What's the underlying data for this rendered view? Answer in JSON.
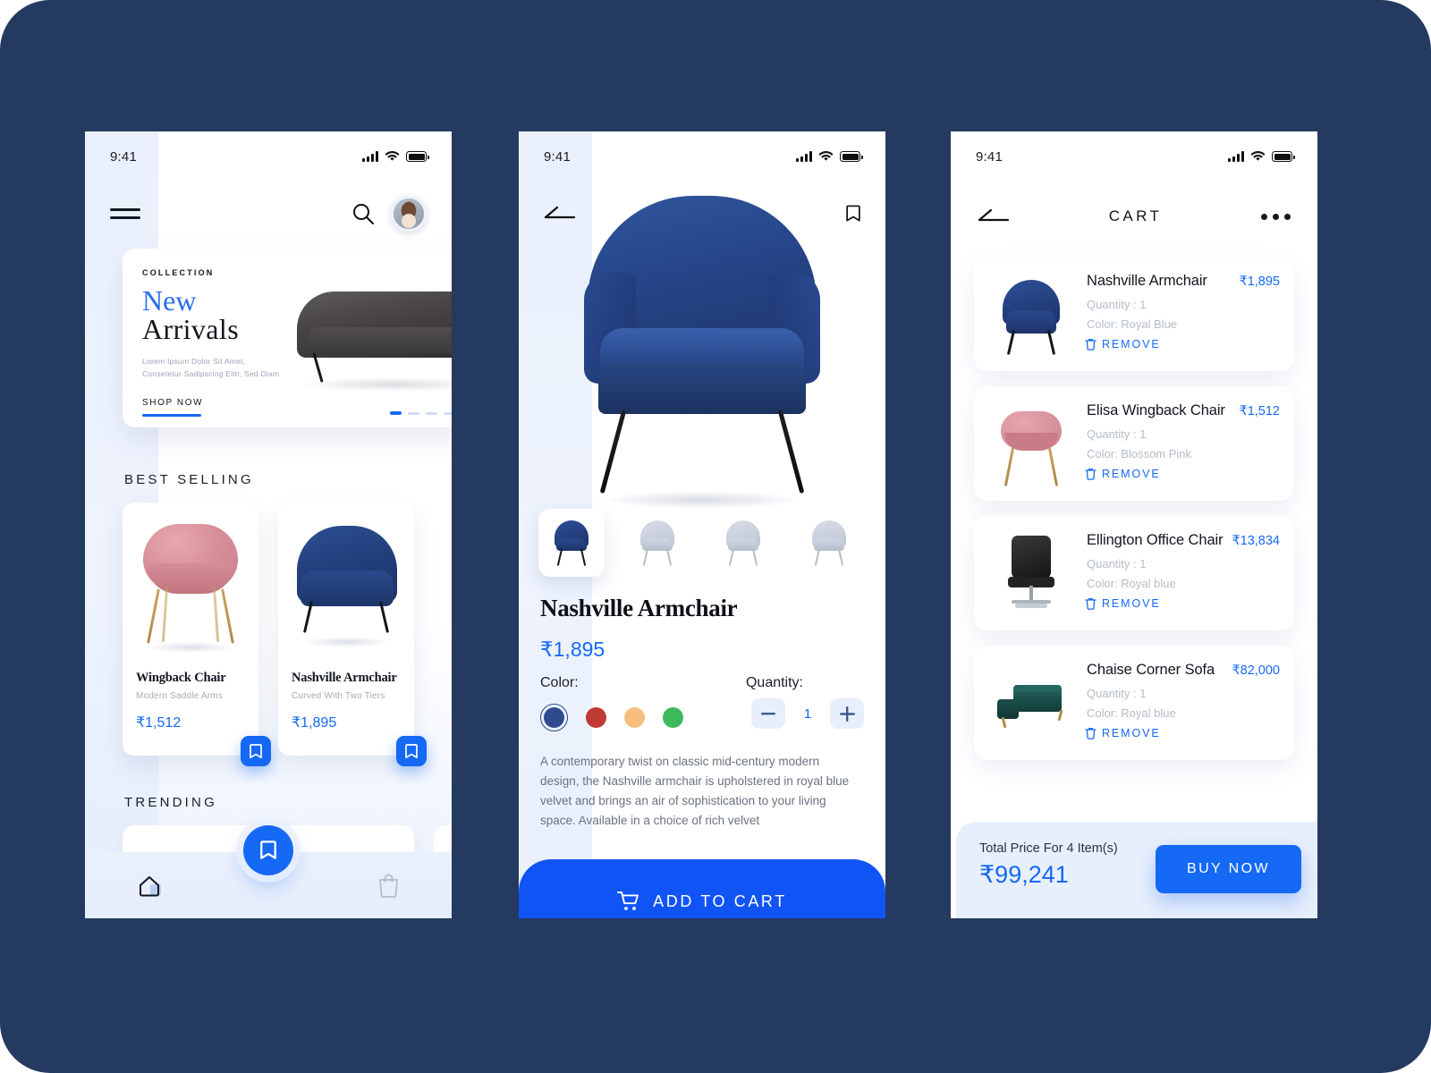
{
  "theme": {
    "page_bg": "#253A60",
    "accent": "#1569F4",
    "text_dark": "#12161F",
    "muted": "#A4ACBA"
  },
  "status_bar": {
    "time": "9:41"
  },
  "home": {
    "menu_icon": "hamburger-icon",
    "search_icon": "search-icon",
    "avatar": "user-avatar",
    "banner": {
      "eyebrow": "COLLECTION",
      "title_line1": "New",
      "title_line2": "Arrivals",
      "subtitle_line1": "Lorem Ipsum Dolor Sit Amet,",
      "subtitle_line2": "Consetetur Sadipscing Elitr, Sed Diam",
      "cta": "SHOP NOW",
      "slides": 4,
      "active_slide": 1
    },
    "sections": [
      {
        "title": "BEST SELLING"
      },
      {
        "title": "TRENDING"
      }
    ],
    "products": [
      {
        "name": "Wingback Chair",
        "desc": "Modern Saddle Arms",
        "price": "₹1,512",
        "bookmark_icon": "bookmark-icon"
      },
      {
        "name": "Nashville Armchair",
        "desc": "Curved With Two Tiers",
        "price": "₹1,895",
        "bookmark_icon": "bookmark-icon"
      }
    ],
    "nav": {
      "home_icon": "home-icon",
      "fab_icon": "bookmark-icon",
      "bag_icon": "shopping-bag-icon"
    }
  },
  "detail": {
    "back_icon": "back-arrow-icon",
    "bookmark_icon": "bookmark-icon",
    "thumbnails": [
      {
        "view": "front",
        "active": true
      },
      {
        "view": "three-quarter",
        "active": false
      },
      {
        "view": "side",
        "active": false
      },
      {
        "view": "back",
        "active": false
      },
      {
        "view": "angle",
        "active": false
      }
    ],
    "title": "Nashville Armchair",
    "price": "₹1,895",
    "color_label": "Color:",
    "colors": [
      {
        "name": "royal-blue",
        "hex": "#2F4B8E",
        "selected": true
      },
      {
        "name": "red",
        "hex": "#C03A34",
        "selected": false
      },
      {
        "name": "peach",
        "hex": "#F9BE7F",
        "selected": false
      },
      {
        "name": "green",
        "hex": "#3CB95C",
        "selected": false
      }
    ],
    "quantity_label": "Quantity:",
    "quantity_value": "1",
    "minus_label": "—",
    "plus_label": "+",
    "description": "A contemporary twist on classic mid-century modern design, the Nashville armchair is upholstered in royal blue velvet and brings an air of sophistication to your living space. Available in a choice of rich velvet",
    "add_to_cart": "ADD TO CART",
    "cart_icon": "shopping-cart-icon"
  },
  "cart": {
    "back_icon": "back-arrow-icon",
    "title": "CART",
    "more_icon": "more-options-icon",
    "remove_label": "REMOVE",
    "trash_icon": "trash-icon",
    "items": [
      {
        "name": "Nashville Armchair",
        "qty": "Quantity : 1",
        "color": "Color: Royal Blue",
        "price": "₹1,895",
        "thumb": "blue-armchair"
      },
      {
        "name": "Elisa Wingback Chair",
        "qty": "Quantity : 1",
        "color": "Color: Blossom Pink",
        "price": "₹1,512",
        "thumb": "pink-chair"
      },
      {
        "name": "Ellington Office Chair",
        "qty": "Quantity : 1",
        "color": "Color: Royal blue",
        "price": "₹13,834",
        "thumb": "black-office-chair"
      },
      {
        "name": "Chaise Corner Sofa",
        "qty": "Quantity : 1",
        "color": "Color: Royal blue",
        "price": "₹82,000",
        "thumb": "green-sofa"
      }
    ],
    "footer": {
      "total_label": "Total Price For 4 Item(s)",
      "total_value": "₹99,241",
      "buy_label": "BUY NOW"
    }
  }
}
